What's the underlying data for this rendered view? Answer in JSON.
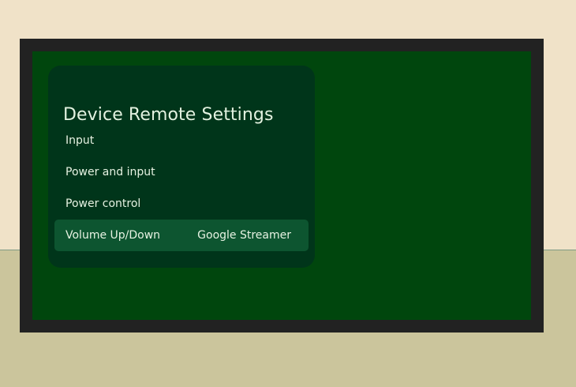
{
  "screen": {
    "title": "Device Remote Settings",
    "items": [
      {
        "label": "Input",
        "value": ""
      },
      {
        "label": "Power and input",
        "value": ""
      },
      {
        "label": "Power control",
        "value": ""
      },
      {
        "label": "Volume Up/Down",
        "value": "Google Streamer",
        "focused": true
      }
    ]
  },
  "colors": {
    "wall": "#f0e2c8",
    "floor": "#cbc59c",
    "bezel": "#222222",
    "screen": "#00460d",
    "panel": "#00351a",
    "focused_item": "#0d5530",
    "text": "#e6f2e2"
  }
}
